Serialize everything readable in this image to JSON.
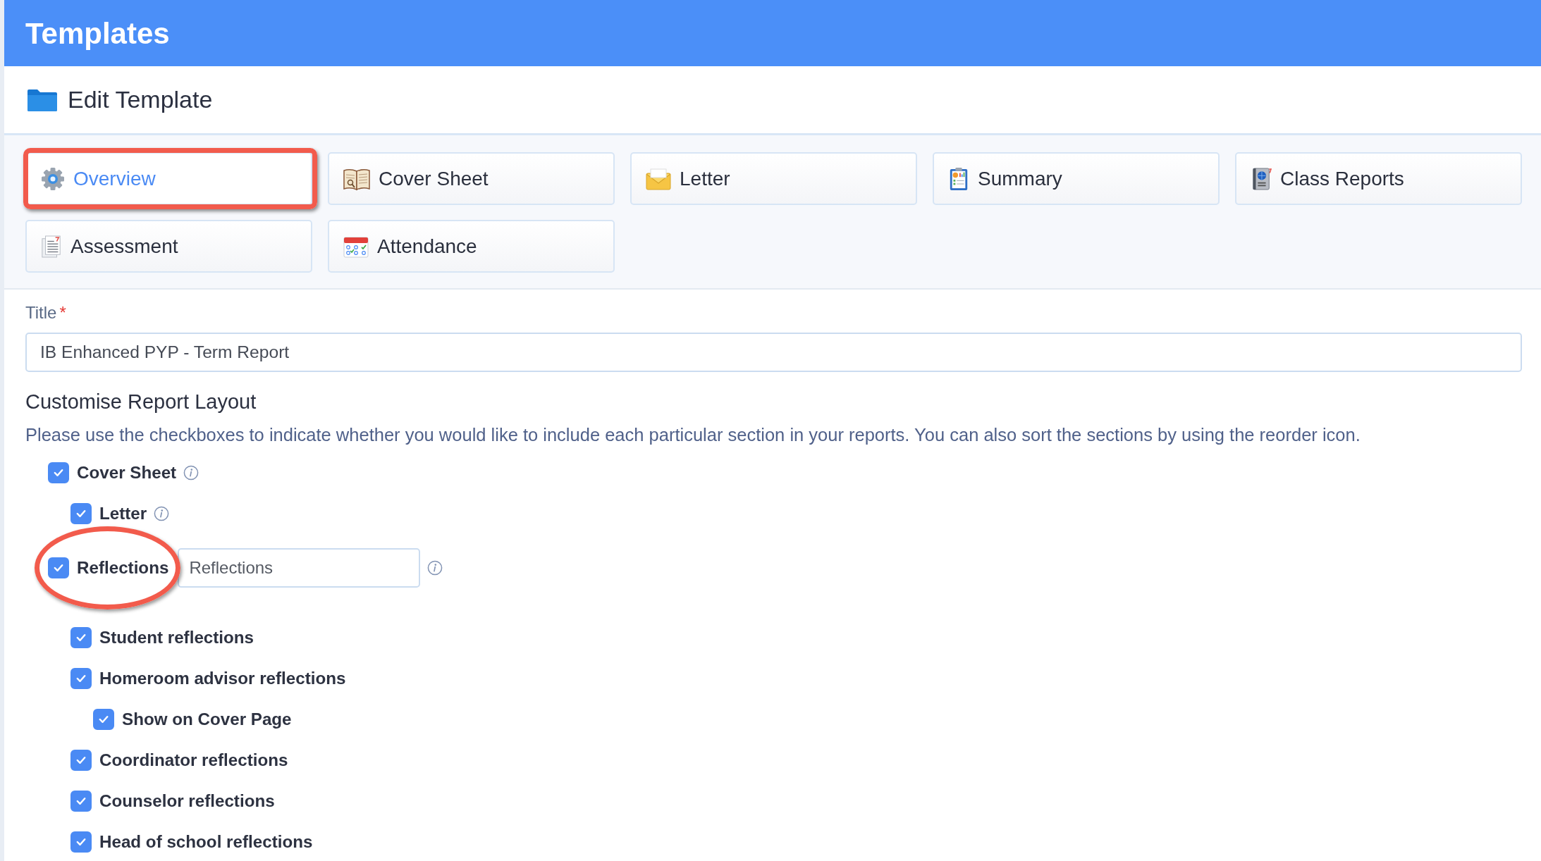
{
  "header": {
    "title": "Templates"
  },
  "edit_bar": {
    "title": "Edit Template"
  },
  "tabs": [
    {
      "label": "Overview",
      "selected": true,
      "annotated": true
    },
    {
      "label": "Cover Sheet",
      "selected": false,
      "annotated": false
    },
    {
      "label": "Letter",
      "selected": false,
      "annotated": false
    },
    {
      "label": "Summary",
      "selected": false,
      "annotated": false
    },
    {
      "label": "Class Reports",
      "selected": false,
      "annotated": false
    },
    {
      "label": "Assessment",
      "selected": false,
      "annotated": false
    },
    {
      "label": "Attendance",
      "selected": false,
      "annotated": false
    }
  ],
  "form": {
    "title_field": {
      "label": "Title",
      "required_mark": "*",
      "value": "IB Enhanced PYP - Term Report"
    },
    "layout_heading": "Customise Report Layout",
    "layout_help": "Please use the checkboxes to indicate whether you would like to include each particular section in your reports. You can also sort the sections by using the reorder icon.",
    "sections": [
      {
        "label": "Cover Sheet",
        "kind": "check",
        "checked": true,
        "info": true,
        "annotated": false,
        "children": [
          {
            "label": "Letter",
            "kind": "check",
            "checked": true,
            "info": true,
            "annotated": false
          }
        ]
      },
      {
        "label": "Reflections",
        "kind": "field",
        "value": "Reflections",
        "checked": true,
        "info": true,
        "annotated": true,
        "children": [
          {
            "label": "Student reflections",
            "kind": "check",
            "checked": true,
            "info": false,
            "annotated": false
          },
          {
            "label": "Homeroom advisor reflections",
            "kind": "check",
            "checked": true,
            "info": false,
            "annotated": false,
            "children": [
              {
                "label": "Show on Cover Page",
                "kind": "check",
                "checked": true,
                "info": false,
                "annotated": false
              }
            ]
          },
          {
            "label": "Coordinator reflections",
            "kind": "check",
            "checked": true,
            "info": false,
            "annotated": false
          },
          {
            "label": "Counselor reflections",
            "kind": "check",
            "checked": true,
            "info": false,
            "annotated": false
          },
          {
            "label": "Head of school reflections",
            "kind": "check",
            "checked": true,
            "info": false,
            "annotated": false
          }
        ]
      }
    ]
  }
}
